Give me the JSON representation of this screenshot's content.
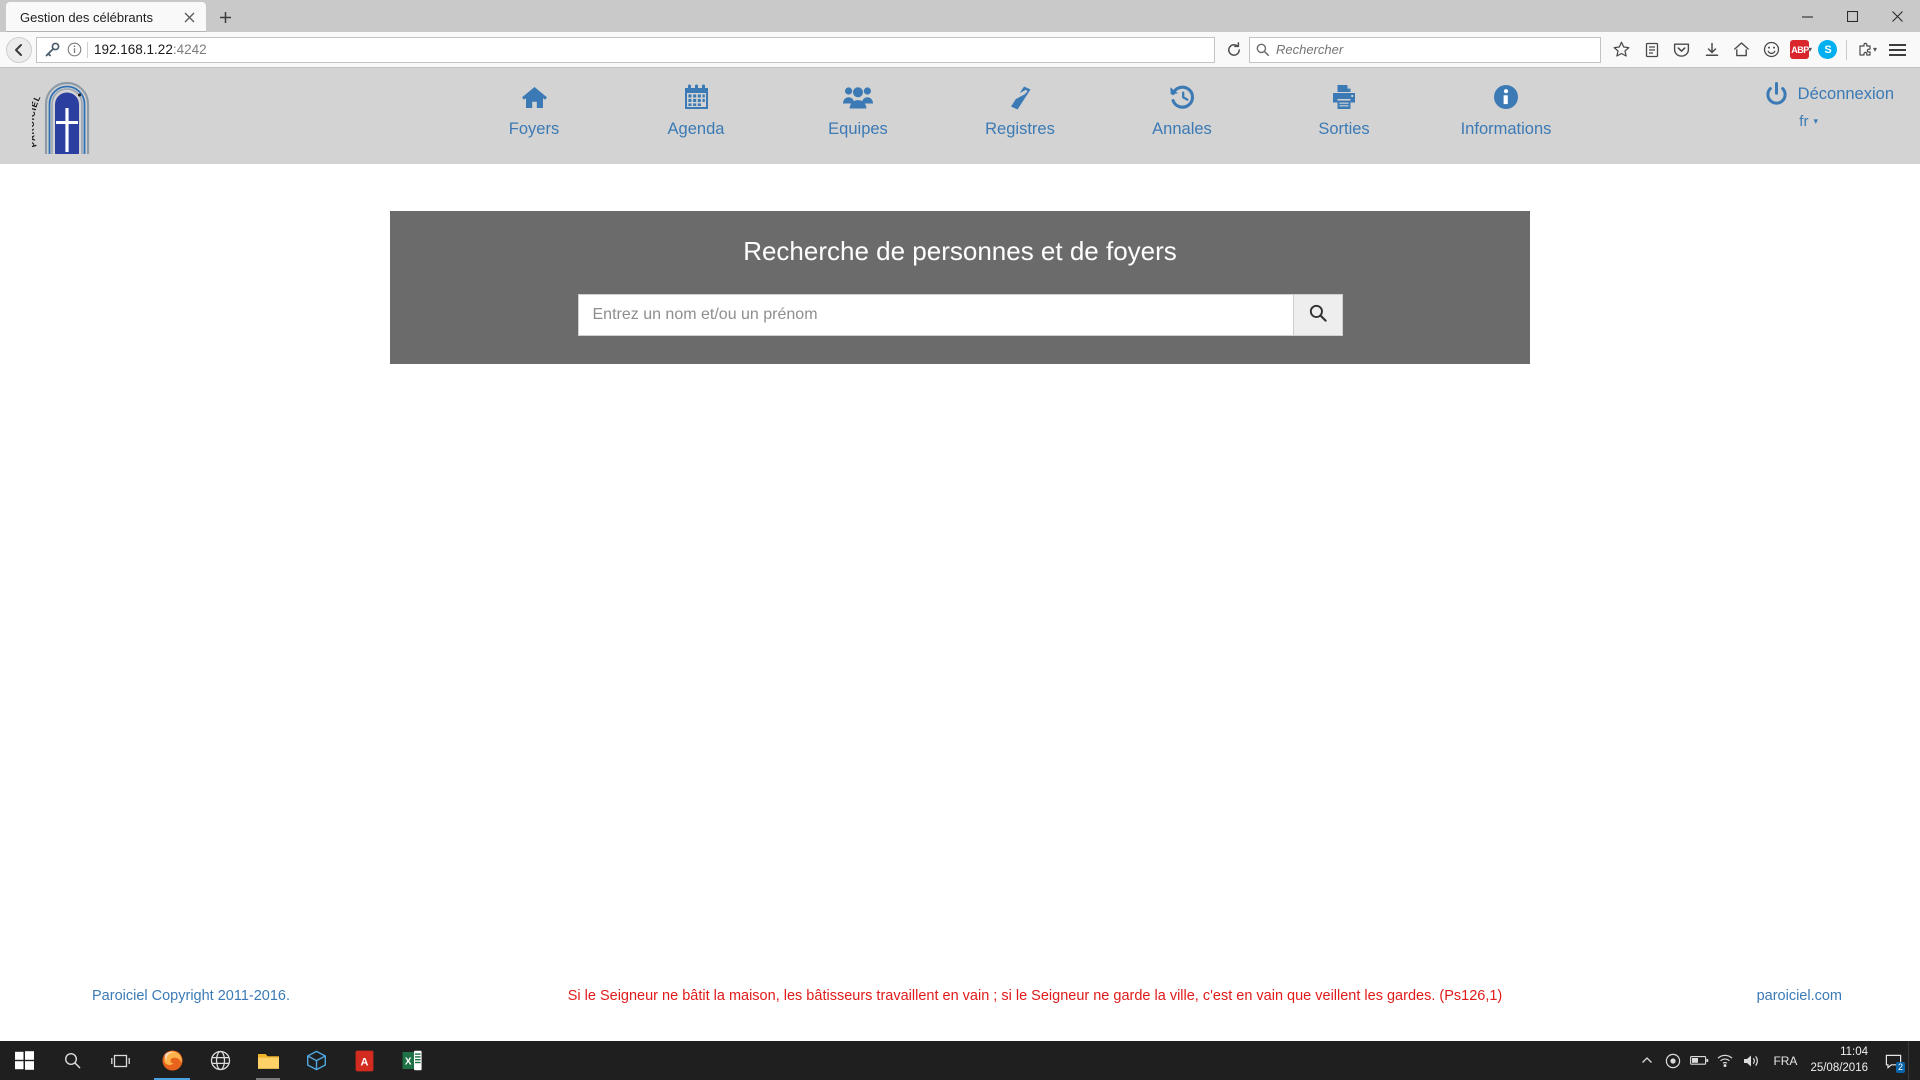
{
  "browser": {
    "tab": {
      "title": "Gestion des célébrants",
      "close_icon": "close-icon"
    },
    "new_tab_icon": "plus-icon",
    "window_controls": {
      "minimize": "minimize-icon",
      "maximize": "maximize-icon",
      "close": "close-icon"
    },
    "back_icon": "back-arrow-icon",
    "identity_key_icon": "key-icon",
    "identity_info_icon": "info-circle-icon",
    "url": {
      "host": "192.168.1.22",
      "port": ":4242"
    },
    "reload_icon": "reload-icon",
    "search": {
      "placeholder": "Rechercher",
      "value": "",
      "icon": "magnifier-icon"
    },
    "toolbar_icons": [
      "bookmark-star-icon",
      "reader-list-icon",
      "pocket-icon",
      "downloads-icon",
      "home-icon",
      "smiley-icon",
      "adblock-plus-icon",
      "skype-icon",
      "extension-icon",
      "menu-hamburger-icon"
    ],
    "adblock_label": "ABP",
    "skype_label": "S"
  },
  "app": {
    "brand": {
      "name": "PAROICIEL",
      "icon": "paroiciel-arch-logo"
    },
    "nav": [
      {
        "label": "Foyers",
        "icon": "home-icon"
      },
      {
        "label": "Agenda",
        "icon": "calendar-icon"
      },
      {
        "label": "Equipes",
        "icon": "users-group-icon"
      },
      {
        "label": "Registres",
        "icon": "book-icon"
      },
      {
        "label": "Annales",
        "icon": "history-clock-icon"
      },
      {
        "label": "Sorties",
        "icon": "printer-icon"
      },
      {
        "label": "Informations",
        "icon": "info-circle-icon"
      }
    ],
    "logout": {
      "label": "Déconnexion",
      "icon": "power-icon"
    },
    "language": {
      "label": "fr",
      "caret": "▾"
    },
    "search_panel": {
      "title": "Recherche de personnes et de foyers",
      "input_placeholder": "Entrez un nom et/ou un prénom",
      "input_value": "",
      "button_icon": "magnifier-icon"
    },
    "footer": {
      "copyright": "Paroiciel Copyright 2011-2016.",
      "verse": "Si le Seigneur ne bâtit la maison, les bâtisseurs travaillent en vain ; si le Seigneur ne garde la ville, c'est en vain que veillent les gardes. (Ps126,1)",
      "site": "paroiciel.com"
    },
    "colors": {
      "nav_bg": "#d3d3d3",
      "nav_link": "#3b7ab5",
      "panel_bg": "#6b6b6b",
      "verse_red": "#e01b1b",
      "footer_link": "#3b7ab5"
    }
  },
  "taskbar": {
    "start_icon": "windows-start-icon",
    "search_icon": "search-icon",
    "taskview_icon": "task-view-icon",
    "apps": [
      {
        "name": "firefox-icon"
      },
      {
        "name": "browser-globe-icon"
      },
      {
        "name": "file-explorer-icon"
      },
      {
        "name": "3d-builder-icon"
      },
      {
        "name": "adobe-reader-icon"
      },
      {
        "name": "excel-icon"
      }
    ],
    "tray_icons": [
      "chevron-up-icon",
      "onedrive-icon",
      "battery-icon",
      "network-icon",
      "volume-icon"
    ],
    "language": "FRA",
    "clock": {
      "time": "11:04",
      "date": "25/08/2016"
    },
    "notifications": {
      "icon": "action-center-icon",
      "count": "2"
    }
  }
}
